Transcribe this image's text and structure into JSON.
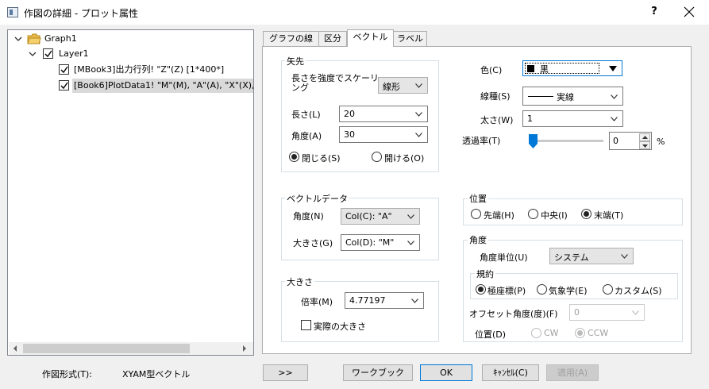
{
  "window": {
    "title": "作図の詳細 - プロット属性",
    "help": "?"
  },
  "tree": {
    "graph": "Graph1",
    "layer": "Layer1",
    "plot1": "[MBook3]出力行列! \"Z\"(Z) [1*400*]",
    "plot2": "[Book6]PlotData1! \"M\"(M), \"A\"(A), \"X\"(X),"
  },
  "tabs": [
    "グラフの線",
    "区分",
    "ベクトル",
    "ラベル"
  ],
  "arrowhead": {
    "title": "矢先",
    "scale_label": "長さを強度でスケーリング",
    "scale_value": "線形",
    "length_label": "長さ(L)",
    "length_value": "20",
    "angle_label": "角度(A)",
    "angle_value": "30",
    "closed_label": "閉じる(S)",
    "open_label": "開ける(O)"
  },
  "line": {
    "color_label": "色(C)",
    "color_value": "黒",
    "style_label": "線種(S)",
    "style_value": "実線",
    "width_label": "太さ(W)",
    "width_value": "1",
    "transparency_label": "透過率(T)",
    "transparency_value": "0",
    "percent": "%"
  },
  "vector_data": {
    "title": "ベクトルデータ",
    "angle_label": "角度(N)",
    "angle_value": "Col(C): \"A\"",
    "magnitude_label": "大きさ(G)",
    "magnitude_value": "Col(D): \"M\""
  },
  "position": {
    "title": "位置",
    "head": "先端(H)",
    "center": "中央(I)",
    "tail": "末端(T)"
  },
  "angle_group": {
    "title": "角度",
    "unit_label": "角度単位(U)",
    "unit_value": "システム",
    "convention_title": "規約",
    "polar": "極座標(P)",
    "meteo": "気象学(E)",
    "custom": "カスタム(S)",
    "offset_label": "オフセット角度(度)(F)",
    "offset_value": "0",
    "dir_label": "位置(D)",
    "cw": "CW",
    "ccw": "CCW"
  },
  "magnitude": {
    "title": "大きさ",
    "multiplier_label": "倍率(M)",
    "multiplier_value": "4.77197",
    "actual_size_label": "実際の大きさ"
  },
  "footer": {
    "plot_type_label": "作図形式(T):",
    "plot_type_value": "XYAM型ベクトル",
    "expand": ">>",
    "workbook": "ワークブック",
    "ok": "OK",
    "cancel": "ｷｬﾝｾﾙ(C)",
    "apply": "適用(A)"
  },
  "colors": {
    "accent": "#0078d7",
    "selection": "#d9d9d9",
    "slider": "#0078d7"
  }
}
